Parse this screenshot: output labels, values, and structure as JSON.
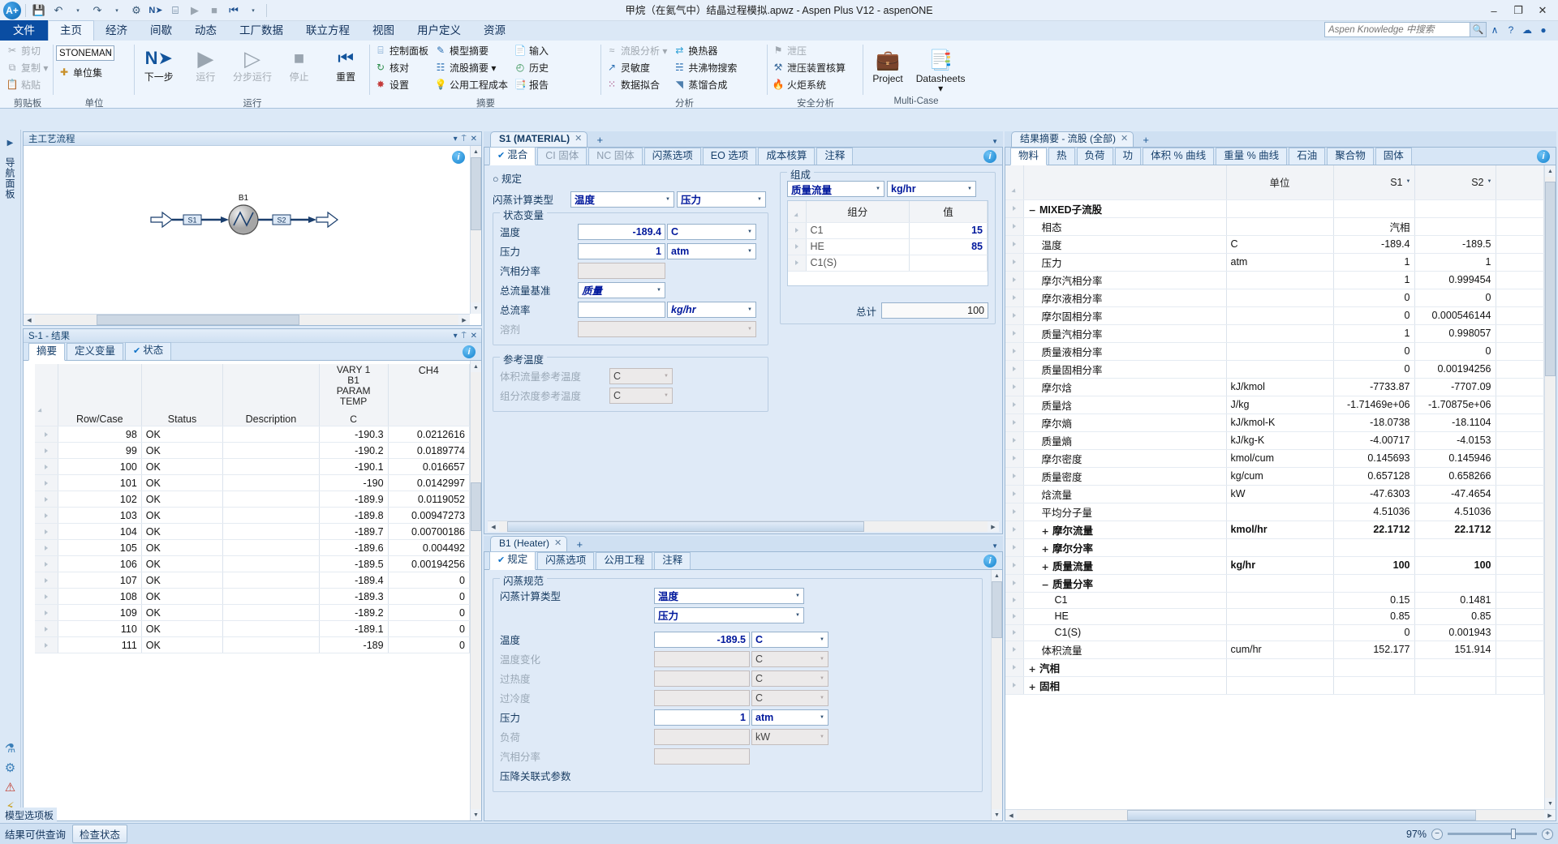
{
  "window": {
    "title": "甲烷（在氦气中）结晶过程模拟.apwz - Aspen Plus V12 - aspenONE",
    "minimize": "–",
    "maximize": "☐",
    "close": "✕",
    "restore": "❐"
  },
  "qat": {
    "logo": "A+",
    "items": [
      {
        "name": "save-icon",
        "glyph": "💾"
      },
      {
        "name": "undo-icon",
        "glyph": "↶"
      },
      {
        "name": "undo-dropdown-icon",
        "glyph": "▾"
      },
      {
        "name": "redo-icon",
        "glyph": "↷"
      },
      {
        "name": "redo-dropdown-icon",
        "glyph": "▾"
      },
      {
        "name": "next-input-icon",
        "glyph": "⚙"
      },
      {
        "name": "run-next-icon",
        "glyph": "N➤"
      },
      {
        "name": "control-panel-icon",
        "glyph": "⌸"
      },
      {
        "name": "run-icon",
        "glyph": "▶"
      },
      {
        "name": "stop-icon",
        "glyph": "■"
      },
      {
        "name": "reset-icon",
        "glyph": "⏮"
      },
      {
        "name": "customize-qat-icon",
        "glyph": "▾"
      }
    ]
  },
  "ribbon": {
    "tabs": [
      {
        "label": "文件",
        "type": "file"
      },
      {
        "label": "主页",
        "type": "active"
      },
      {
        "label": "经济",
        "type": "normal"
      },
      {
        "label": "间歇",
        "type": "normal"
      },
      {
        "label": "动态",
        "type": "normal"
      },
      {
        "label": "工厂数据",
        "type": "normal"
      },
      {
        "label": "联立方程",
        "type": "normal"
      },
      {
        "label": "视图",
        "type": "normal"
      },
      {
        "label": "用户定义",
        "type": "normal"
      },
      {
        "label": "资源",
        "type": "normal"
      }
    ],
    "search": {
      "placeholder": "Aspen Knowledge 中搜索",
      "icon": "🔍"
    },
    "help_icons": [
      {
        "name": "minimize-ribbon-icon",
        "glyph": "∧"
      },
      {
        "name": "help-icon",
        "glyph": "?"
      },
      {
        "name": "aspen-cloud-icon",
        "glyph": "☁"
      },
      {
        "name": "account-icon",
        "glyph": "●"
      }
    ],
    "groups": [
      {
        "name": "clipboard",
        "label": "剪贴板",
        "buttons": [
          {
            "label": "剪切",
            "icon": "✂",
            "disabled": true
          },
          {
            "label": "复制 ▾",
            "icon": "⧉",
            "disabled": true
          },
          {
            "label": "粘贴",
            "icon": "📋",
            "disabled": true
          }
        ]
      },
      {
        "name": "units",
        "label": "单位",
        "unit_set_value": "STONEMAN",
        "buttons": [
          {
            "label": "单位集",
            "icon": "✚",
            "disabled": false
          }
        ]
      },
      {
        "name": "run",
        "label": "运行",
        "buttons": [
          {
            "label": "下一步",
            "icon": "N➤",
            "disabled": false
          },
          {
            "label": "运行",
            "icon": "▶",
            "disabled": true
          },
          {
            "label": "分步运行",
            "icon": "▷",
            "disabled": true
          },
          {
            "label": "停止",
            "icon": "■",
            "disabled": true
          },
          {
            "label": "重置",
            "icon": "⏮",
            "disabled": false
          }
        ]
      },
      {
        "name": "summary",
        "label": "摘要",
        "col1": [
          {
            "label": "控制面板",
            "icon": "⌸",
            "disabled": false
          },
          {
            "label": "核对",
            "icon": "↻",
            "disabled": false
          },
          {
            "label": "设置",
            "icon": "✸",
            "disabled": false
          }
        ],
        "col2": [
          {
            "label": "模型摘要",
            "icon": "✎",
            "disabled": false
          },
          {
            "label": "流股摘要 ▾",
            "icon": "☷",
            "disabled": false
          },
          {
            "label": "公用工程成本",
            "icon": "💡",
            "disabled": false
          }
        ],
        "col3": [
          {
            "label": "输入",
            "icon": "📄",
            "disabled": false
          },
          {
            "label": "历史",
            "icon": "◴",
            "disabled": false
          },
          {
            "label": "报告",
            "icon": "📑",
            "disabled": false
          }
        ]
      },
      {
        "name": "analysis",
        "label": "分析",
        "col1": [
          {
            "label": "流股分析 ▾",
            "icon": "≈",
            "disabled": true
          },
          {
            "label": "灵敏度",
            "icon": "↗",
            "disabled": false
          },
          {
            "label": "数据拟合",
            "icon": "⁙",
            "disabled": false
          }
        ],
        "col2": [
          {
            "label": "换热器",
            "icon": "⇄",
            "disabled": false
          },
          {
            "label": "共沸物搜索",
            "icon": "☵",
            "disabled": false
          },
          {
            "label": "蒸馏合成",
            "icon": "◥",
            "disabled": false
          }
        ]
      },
      {
        "name": "safety",
        "label": "安全分析",
        "col1": [
          {
            "label": "泄压",
            "icon": "⚑",
            "disabled": true
          },
          {
            "label": "泄压装置核算",
            "icon": "⚒",
            "disabled": false
          },
          {
            "label": "火炬系统",
            "icon": "🔥",
            "disabled": false
          }
        ]
      },
      {
        "name": "multicase",
        "label": "Multi-Case",
        "big": [
          {
            "label": "Project",
            "icon": "💼"
          },
          {
            "label": "Datasheets ▾",
            "icon": "📑"
          }
        ]
      }
    ]
  },
  "navstrip": {
    "label": "导航面板",
    "icons": [
      {
        "name": "properties-icon",
        "glyph": "⚗"
      },
      {
        "name": "simulation-icon",
        "glyph": "⚙"
      },
      {
        "name": "safety-analysis-icon",
        "glyph": "⚠"
      },
      {
        "name": "energy-analysis-icon",
        "glyph": "⚡"
      }
    ]
  },
  "flowsheet": {
    "panel_title": "主工艺流程",
    "pin": "⍑",
    "collapse": "▾",
    "close": "✕",
    "block_label": "B1",
    "stream_in": "S1",
    "stream_out": "S2"
  },
  "results_pane": {
    "panel_title": "S-1 - 结果",
    "pin": "⍑",
    "collapse": "▾",
    "close": "✕",
    "tabs": [
      {
        "label": "摘要",
        "active": true,
        "check": false
      },
      {
        "label": "定义变量",
        "active": false,
        "check": false
      },
      {
        "label": "状态",
        "active": false,
        "check": true
      }
    ],
    "columns": [
      "",
      "Row/Case",
      "Status",
      "Description",
      "VARY  1\nB1\nPARAM\nTEMP\n\nC",
      "CH4"
    ],
    "col_header_main": [
      "Row/Case",
      "Status",
      "Description"
    ],
    "col_vary": {
      "l1": "VARY  1",
      "l2": "B1",
      "l3": "PARAM",
      "l4": "TEMP",
      "unit": "C"
    },
    "col_ch4": {
      "l1": "CH4"
    },
    "rows": [
      {
        "case": "98",
        "status": "OK",
        "desc": "",
        "temp": "-190.3",
        "ch4": "0.0212616"
      },
      {
        "case": "99",
        "status": "OK",
        "desc": "",
        "temp": "-190.2",
        "ch4": "0.0189774"
      },
      {
        "case": "100",
        "status": "OK",
        "desc": "",
        "temp": "-190.1",
        "ch4": "0.016657"
      },
      {
        "case": "101",
        "status": "OK",
        "desc": "",
        "temp": "-190",
        "ch4": "0.0142997"
      },
      {
        "case": "102",
        "status": "OK",
        "desc": "",
        "temp": "-189.9",
        "ch4": "0.0119052"
      },
      {
        "case": "103",
        "status": "OK",
        "desc": "",
        "temp": "-189.8",
        "ch4": "0.00947273"
      },
      {
        "case": "104",
        "status": "OK",
        "desc": "",
        "temp": "-189.7",
        "ch4": "0.00700186"
      },
      {
        "case": "105",
        "status": "OK",
        "desc": "",
        "temp": "-189.6",
        "ch4": "0.004492"
      },
      {
        "case": "106",
        "status": "OK",
        "desc": "",
        "temp": "-189.5",
        "ch4": "0.00194256"
      },
      {
        "case": "107",
        "status": "OK",
        "desc": "",
        "temp": "-189.4",
        "ch4": "0"
      },
      {
        "case": "108",
        "status": "OK",
        "desc": "",
        "temp": "-189.3",
        "ch4": "0"
      },
      {
        "case": "109",
        "status": "OK",
        "desc": "",
        "temp": "-189.2",
        "ch4": "0"
      },
      {
        "case": "110",
        "status": "OK",
        "desc": "",
        "temp": "-189.1",
        "ch4": "0"
      },
      {
        "case": "111",
        "status": "OK",
        "desc": "",
        "temp": "-189",
        "ch4": "0"
      }
    ]
  },
  "s1_panel": {
    "doc_tab": "S1 (MATERIAL)",
    "doc_tab_close": "✕",
    "doc_tab_plus": "+",
    "tabs": [
      {
        "label": "混合",
        "active": true,
        "check": true,
        "dim": false
      },
      {
        "label": "CI 固体",
        "active": false,
        "check": false,
        "dim": true
      },
      {
        "label": "NC 固体",
        "active": false,
        "check": false,
        "dim": true
      },
      {
        "label": "闪蒸选项",
        "active": false,
        "check": false,
        "dim": false
      },
      {
        "label": "EO 选项",
        "active": false,
        "check": false,
        "dim": false
      },
      {
        "label": "成本核算",
        "active": false,
        "check": false,
        "dim": false
      },
      {
        "label": "注释",
        "active": false,
        "check": false,
        "dim": false
      }
    ],
    "spec_group": "规定",
    "flash_type_label": "闪蒸计算类型",
    "flash_type_1": "温度",
    "flash_type_2": "压力",
    "state_group": "状态变量",
    "fields": [
      {
        "label": "温度",
        "value": "-189.4",
        "unit": "C",
        "disabled": false
      },
      {
        "label": "压力",
        "value": "1",
        "unit": "atm",
        "disabled": false
      },
      {
        "label": "汽相分率",
        "value": "",
        "unit": "",
        "disabled": true
      }
    ],
    "basis_label": "总流量基准",
    "basis_value": "质量",
    "totalflow_label": "总流率",
    "totalflow_value": "",
    "totalflow_unit": "kg/hr",
    "solvent_label": "溶剂",
    "solvent_value": "",
    "ref_group": "参考温度",
    "ref_vol_label": "体积流量参考温度",
    "ref_vol_unit": "C",
    "ref_conc_label": "组分浓度参考温度",
    "ref_conc_unit": "C",
    "comp_group": "组成",
    "comp_basis": "质量流量",
    "comp_unit": "kg/hr",
    "comp_headers": [
      "组分",
      "值"
    ],
    "comp_rows": [
      {
        "comp": "C1",
        "value": "15"
      },
      {
        "comp": "HE",
        "value": "85"
      },
      {
        "comp": "C1(S)",
        "value": ""
      }
    ],
    "total_label": "总计",
    "total_value": "100"
  },
  "b1_panel": {
    "doc_tab": "B1 (Heater)",
    "doc_tab_close": "✕",
    "doc_tab_plus": "+",
    "tabs": [
      {
        "label": "规定",
        "active": true,
        "check": true
      },
      {
        "label": "闪蒸选项",
        "active": false,
        "check": false
      },
      {
        "label": "公用工程",
        "active": false,
        "check": false
      },
      {
        "label": "注释",
        "active": false,
        "check": false
      }
    ],
    "spec_group": "闪蒸规范",
    "flash_type_label": "闪蒸计算类型",
    "flash_type_1": "温度",
    "flash_type_2": "压力",
    "rows": [
      {
        "label": "温度",
        "value": "-189.5",
        "unit": "C",
        "disabled": false
      },
      {
        "label": "温度变化",
        "value": "",
        "unit": "C",
        "disabled": true
      },
      {
        "label": "过热度",
        "value": "",
        "unit": "C",
        "disabled": true
      },
      {
        "label": "过冷度",
        "value": "",
        "unit": "C",
        "disabled": true
      },
      {
        "label": "压力",
        "value": "1",
        "unit": "atm",
        "disabled": false
      },
      {
        "label": "负荷",
        "value": "",
        "unit": "kW",
        "disabled": true
      },
      {
        "label": "汽相分率",
        "value": "",
        "unit": "",
        "disabled": true
      }
    ],
    "last_label": "压降关联式参数"
  },
  "stream_results": {
    "doc_tab": "结果摘要 - 流股 (全部)",
    "doc_tab_close": "✕",
    "doc_tab_plus": "+",
    "tabs": [
      {
        "label": "物料",
        "active": true
      },
      {
        "label": "热",
        "active": false
      },
      {
        "label": "负荷",
        "active": false
      },
      {
        "label": "功",
        "active": false
      },
      {
        "label": "体积 % 曲线",
        "active": false
      },
      {
        "label": "重量 % 曲线",
        "active": false
      },
      {
        "label": "石油",
        "active": false
      },
      {
        "label": "聚合物",
        "active": false
      },
      {
        "label": "固体",
        "active": false
      }
    ],
    "headers": {
      "units": "单位",
      "col_s1": "S1",
      "col_s2": "S2",
      "col_blank": ""
    },
    "rows": [
      {
        "label": "MIXED子流股",
        "unit": "",
        "s1": "",
        "s2": "",
        "level": 0,
        "expander": "−",
        "bold": true
      },
      {
        "label": "相态",
        "unit": "",
        "s1": "汽相",
        "s2": "",
        "level": 1,
        "expander": "",
        "bold": false
      },
      {
        "label": "温度",
        "unit": "C",
        "s1": "-189.4",
        "s2": "-189.5",
        "level": 1,
        "expander": "",
        "bold": false
      },
      {
        "label": "压力",
        "unit": "atm",
        "s1": "1",
        "s2": "1",
        "level": 1,
        "expander": "",
        "bold": false
      },
      {
        "label": "摩尔汽相分率",
        "unit": "",
        "s1": "1",
        "s2": "0.999454",
        "level": 1,
        "expander": "",
        "bold": false
      },
      {
        "label": "摩尔液相分率",
        "unit": "",
        "s1": "0",
        "s2": "0",
        "level": 1,
        "expander": "",
        "bold": false
      },
      {
        "label": "摩尔固相分率",
        "unit": "",
        "s1": "0",
        "s2": "0.000546144",
        "level": 1,
        "expander": "",
        "bold": false
      },
      {
        "label": "质量汽相分率",
        "unit": "",
        "s1": "1",
        "s2": "0.998057",
        "level": 1,
        "expander": "",
        "bold": false
      },
      {
        "label": "质量液相分率",
        "unit": "",
        "s1": "0",
        "s2": "0",
        "level": 1,
        "expander": "",
        "bold": false
      },
      {
        "label": "质量固相分率",
        "unit": "",
        "s1": "0",
        "s2": "0.00194256",
        "level": 1,
        "expander": "",
        "bold": false
      },
      {
        "label": "摩尔焓",
        "unit": "kJ/kmol",
        "s1": "-7733.87",
        "s2": "-7707.09",
        "level": 1,
        "expander": "",
        "bold": false
      },
      {
        "label": "质量焓",
        "unit": "J/kg",
        "s1": "-1.71469e+06",
        "s2": "-1.70875e+06",
        "level": 1,
        "expander": "",
        "bold": false
      },
      {
        "label": "摩尔熵",
        "unit": "kJ/kmol-K",
        "s1": "-18.0738",
        "s2": "-18.1104",
        "level": 1,
        "expander": "",
        "bold": false
      },
      {
        "label": "质量熵",
        "unit": "kJ/kg-K",
        "s1": "-4.00717",
        "s2": "-4.0153",
        "level": 1,
        "expander": "",
        "bold": false
      },
      {
        "label": "摩尔密度",
        "unit": "kmol/cum",
        "s1": "0.145693",
        "s2": "0.145946",
        "level": 1,
        "expander": "",
        "bold": false
      },
      {
        "label": "质量密度",
        "unit": "kg/cum",
        "s1": "0.657128",
        "s2": "0.658266",
        "level": 1,
        "expander": "",
        "bold": false
      },
      {
        "label": "焓流量",
        "unit": "kW",
        "s1": "-47.6303",
        "s2": "-47.4654",
        "level": 1,
        "expander": "",
        "bold": false
      },
      {
        "label": "平均分子量",
        "unit": "",
        "s1": "4.51036",
        "s2": "4.51036",
        "level": 1,
        "expander": "",
        "bold": false
      },
      {
        "label": "摩尔流量",
        "unit": "kmol/hr",
        "s1": "22.1712",
        "s2": "22.1712",
        "level": 1,
        "expander": "+",
        "bold": true
      },
      {
        "label": "摩尔分率",
        "unit": "",
        "s1": "",
        "s2": "",
        "level": 1,
        "expander": "+",
        "bold": true
      },
      {
        "label": "质量流量",
        "unit": "kg/hr",
        "s1": "100",
        "s2": "100",
        "level": 1,
        "expander": "+",
        "bold": true
      },
      {
        "label": "质量分率",
        "unit": "",
        "s1": "",
        "s2": "",
        "level": 1,
        "expander": "−",
        "bold": true
      },
      {
        "label": "C1",
        "unit": "",
        "s1": "0.15",
        "s2": "0.1481",
        "level": 2,
        "expander": "",
        "bold": false
      },
      {
        "label": "HE",
        "unit": "",
        "s1": "0.85",
        "s2": "0.85",
        "level": 2,
        "expander": "",
        "bold": false
      },
      {
        "label": "C1(S)",
        "unit": "",
        "s1": "0",
        "s2": "0.001943",
        "level": 2,
        "expander": "",
        "bold": false
      },
      {
        "label": "体积流量",
        "unit": "cum/hr",
        "s1": "152.177",
        "s2": "151.914",
        "level": 1,
        "expander": "",
        "bold": false
      },
      {
        "label": "汽相",
        "unit": "",
        "s1": "",
        "s2": "",
        "level": 0,
        "expander": "+",
        "bold": true
      },
      {
        "label": "固相",
        "unit": "",
        "s1": "",
        "s2": "",
        "level": 0,
        "expander": "+",
        "bold": true
      }
    ]
  },
  "statusbar": {
    "left_text": "结果可供查询",
    "check_button": "检查状态",
    "model_label": "模型选项板",
    "zoom": "97%",
    "zoom_minus": "−",
    "zoom_plus": "+"
  }
}
